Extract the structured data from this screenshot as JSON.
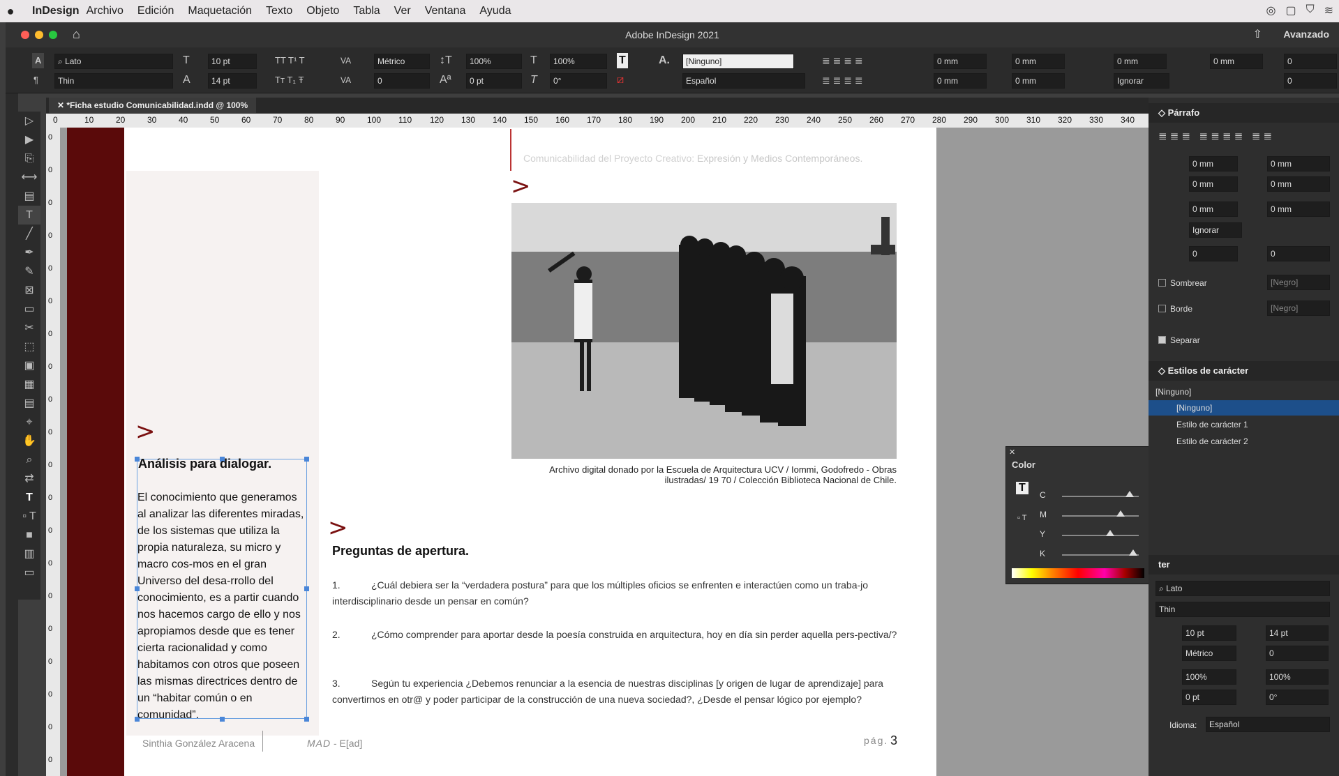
{
  "menubar": {
    "app": "InDesign",
    "items": [
      "Archivo",
      "Edición",
      "Maquetación",
      "Texto",
      "Objeto",
      "Tabla",
      "Ver",
      "Ventana",
      "Ayuda"
    ]
  },
  "titlebar": {
    "title": "Adobe InDesign 2021",
    "workspace": "Avanzado"
  },
  "control": {
    "font_family": "Lato",
    "font_style": "Thin",
    "font_size": "10 pt",
    "leading": "14 pt",
    "kerning": "Métrico",
    "tracking": "0",
    "vscale": "100%",
    "hscale": "100%",
    "baseline": "0 pt",
    "skew": "0°",
    "char_style": "[Ninguno]",
    "language": "Español",
    "indent_left": "0 mm",
    "indent_right": "0 mm",
    "indent_first": "0 mm",
    "indent_last": "0 mm",
    "space_before": "0 mm",
    "space_after": "0 mm",
    "space_before2": "0 mm",
    "space_after2": "0 mm",
    "grid": "Ignorar",
    "drop_lines": "0",
    "drop_chars": "0"
  },
  "document": {
    "tab": "*Ficha estudio Comunicabilidad.indd @ 100%"
  },
  "ruler": {
    "h": [
      "0",
      "10",
      "20",
      "30",
      "40",
      "50",
      "60",
      "70",
      "80",
      "90",
      "100",
      "110",
      "120",
      "130",
      "140",
      "150",
      "160",
      "170",
      "180",
      "190",
      "200",
      "210",
      "220",
      "230",
      "240",
      "250",
      "260",
      "270",
      "280",
      "290",
      "300",
      "310",
      "320",
      "330",
      "340"
    ],
    "v": [
      "0",
      "0",
      "0",
      "0",
      "0",
      "0",
      "0",
      "0",
      "0",
      "0",
      "0",
      "0",
      "0",
      "0",
      "0",
      "0",
      "0",
      "0",
      "0",
      "0"
    ]
  },
  "page": {
    "header_a": "Comunicabilidad del Proyecto Creativo:",
    "header_b": "Expresión y Medios Contemporáneos.",
    "caption": "Archivo digital donado por la Escuela de Arquitectura UCV / Iommi, Godofredo - Obras ilustradas/ 19 70 / Colección Biblioteca Nacional de Chile.",
    "chevron": ">",
    "ana_title": "Análisis para dialogar.",
    "ana_body": "El conocimiento que generamos al analizar las diferentes miradas, de los sistemas que utiliza la propia naturaleza, su micro y macro cos-mos en el gran Universo del desa-rrollo del conocimiento, es a partir cuando nos hacemos cargo de ello y nos apropiamos desde que es tener cierta racionalidad y como habitamos con otros que poseen las mismas directrices dentro de un “habitar común o en comunidad”.",
    "preg_title": "Preguntas de apertura.",
    "questions": [
      {
        "n": "1.",
        "text": "¿Cuál debiera ser la “verdadera postura” para que los múltiples oficios se enfrenten e interactúen como un traba-jo interdisciplinario desde un pensar en común?"
      },
      {
        "n": "2.",
        "text": "¿Cómo comprender para aportar desde la poesía construida en arquitectura, hoy en día sin perder aquella pers-pectiva/?"
      },
      {
        "n": "3.",
        "text": "Según tu experiencia ¿Debemos renunciar a la esencia de nuestras disciplinas [y origen de lugar de aprendizaje] para convertirnos en otr@ y poder participar de la construcción de una nueva sociedad?, ¿Desde el pensar lógico por ejemplo?"
      }
    ],
    "footer_author": "Sinthia González Aracena",
    "footer_mad": "MAD",
    "footer_ead": "- E[ad]",
    "footer_pag": "pág.",
    "footer_num": "3"
  },
  "parrafo": {
    "title": "Párrafo",
    "f1": "0 mm",
    "f2": "0 mm",
    "f3": "0 mm",
    "f4": "0 mm",
    "f5": "0 mm",
    "f6": "0 mm",
    "grid": "Ignorar",
    "d1": "0",
    "d2": "0",
    "sombrear": "Sombrear",
    "borde": "Borde",
    "separar": "Separar",
    "negro": "[Negro]"
  },
  "estilos": {
    "title": "Estilos de carácter",
    "current": "[Ninguno]",
    "items": [
      "[Ninguno]",
      "Estilo de carácter 1",
      "Estilo de carácter 2"
    ]
  },
  "color": {
    "title": "Color",
    "labels": [
      "C",
      "M",
      "Y",
      "K"
    ],
    "y_value": "61,64",
    "k_value": "95,89",
    "pct": "%"
  },
  "caracter": {
    "title": "ter",
    "family": "Lato",
    "style": "Thin",
    "size": "10 pt",
    "leading": "14 pt",
    "kerning": "Métrico",
    "tracking": "0",
    "vscale": "100%",
    "hscale": "100%",
    "baseline": "0 pt",
    "skew": "0°",
    "idioma_label": "Idioma:",
    "idioma": "Español"
  }
}
